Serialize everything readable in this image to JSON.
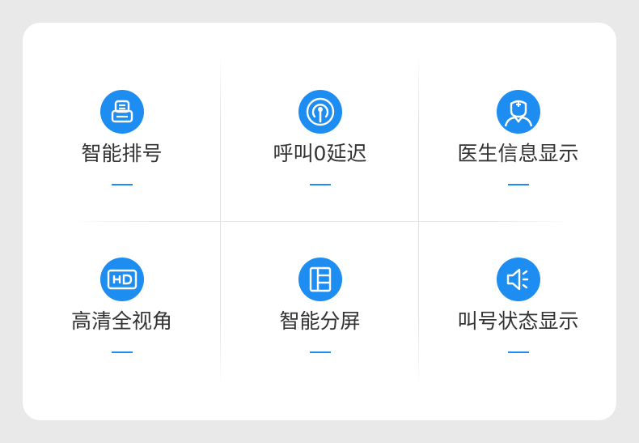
{
  "features": [
    {
      "label": "智能排号",
      "icon": "queue-ticket-icon"
    },
    {
      "label": "呼叫0延迟",
      "icon": "signal-broadcast-icon"
    },
    {
      "label": "医生信息显示",
      "icon": "doctor-icon"
    },
    {
      "label": "高清全视角",
      "icon": "hd-icon"
    },
    {
      "label": "智能分屏",
      "icon": "split-screen-icon"
    },
    {
      "label": "叫号状态显示",
      "icon": "speaker-icon"
    }
  ],
  "colors": {
    "accent": "#1e8df1",
    "background": "#e9e9e9",
    "card": "#ffffff",
    "text": "#333333"
  }
}
